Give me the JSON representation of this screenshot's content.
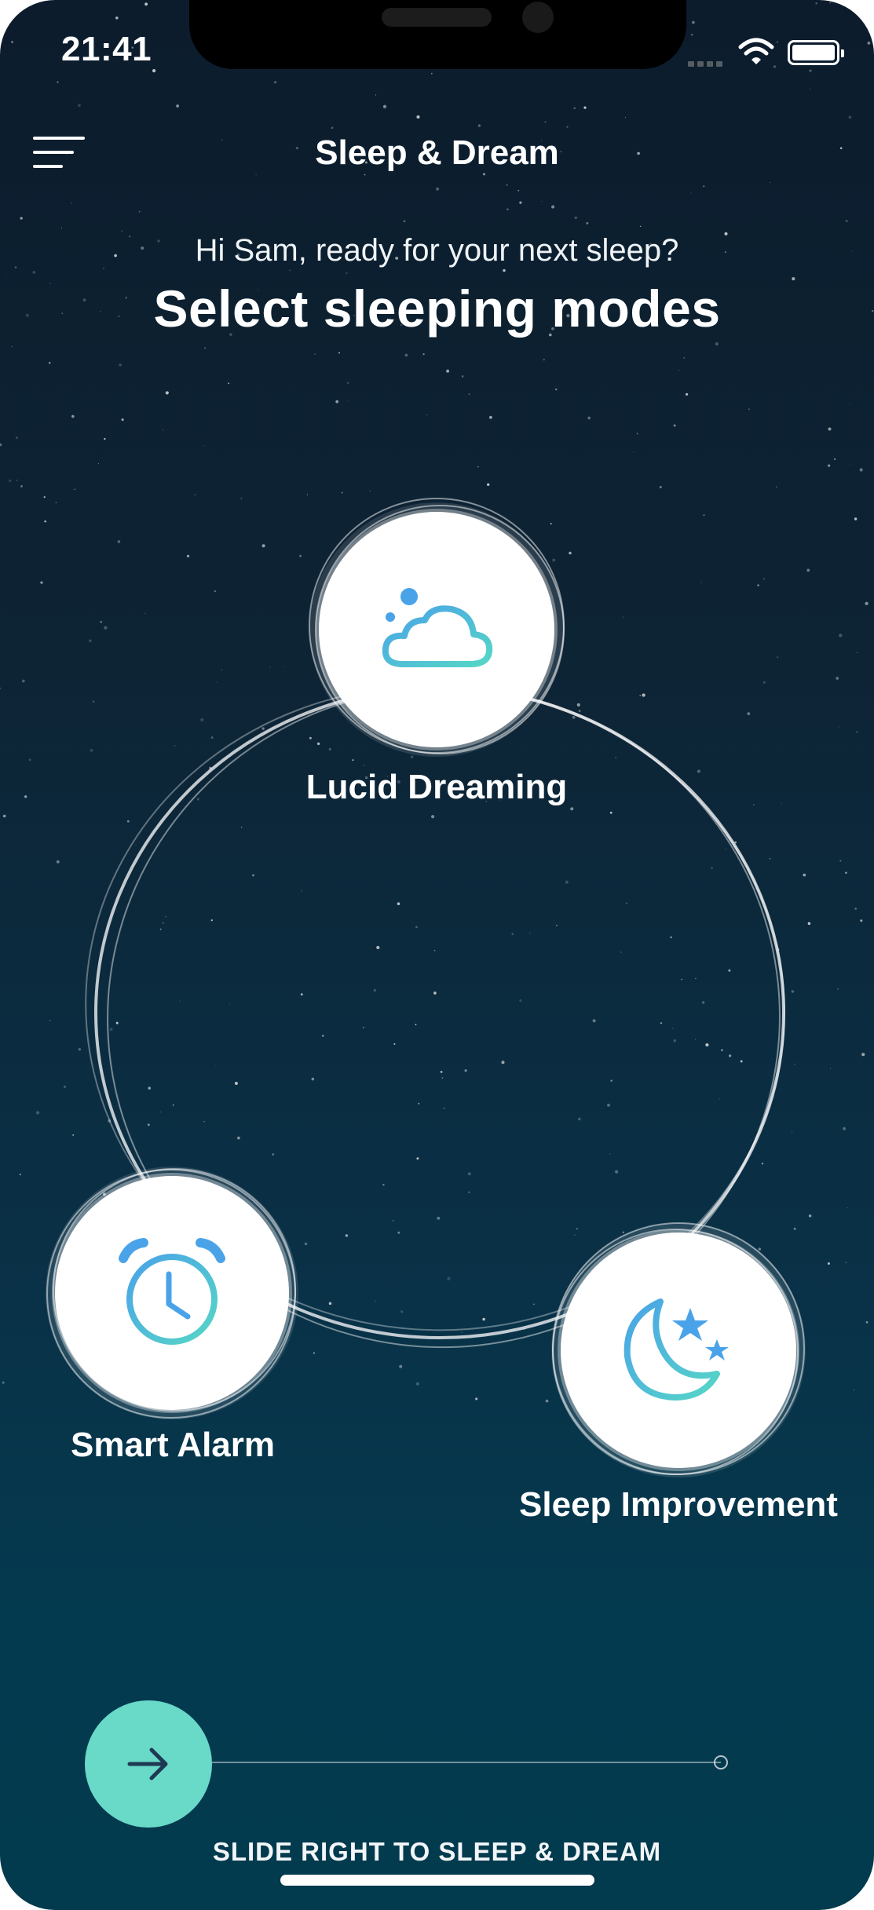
{
  "status_bar": {
    "time": "21:41"
  },
  "header": {
    "title": "Sleep & Dream",
    "menu_icon": "hamburger-menu-icon"
  },
  "intro": {
    "greeting": "Hi Sam, ready for your next sleep?",
    "headline": "Select sleeping modes"
  },
  "modes": [
    {
      "label": "Lucid Dreaming",
      "icon": "cloud-icon"
    },
    {
      "label": "Smart Alarm",
      "icon": "alarm-clock-icon"
    },
    {
      "label": "Sleep Improvement",
      "icon": "moon-stars-icon"
    }
  ],
  "slider": {
    "caption": "SLIDE RIGHT TO SLEEP & DREAM",
    "knob_icon": "arrow-right-icon",
    "knob_color": "#69d9c8"
  },
  "colors": {
    "background_top": "#0c1c2c",
    "background_bottom": "#023a4e",
    "icon_gradient_start": "#4aa3e8",
    "icon_gradient_end": "#56d6c6"
  }
}
